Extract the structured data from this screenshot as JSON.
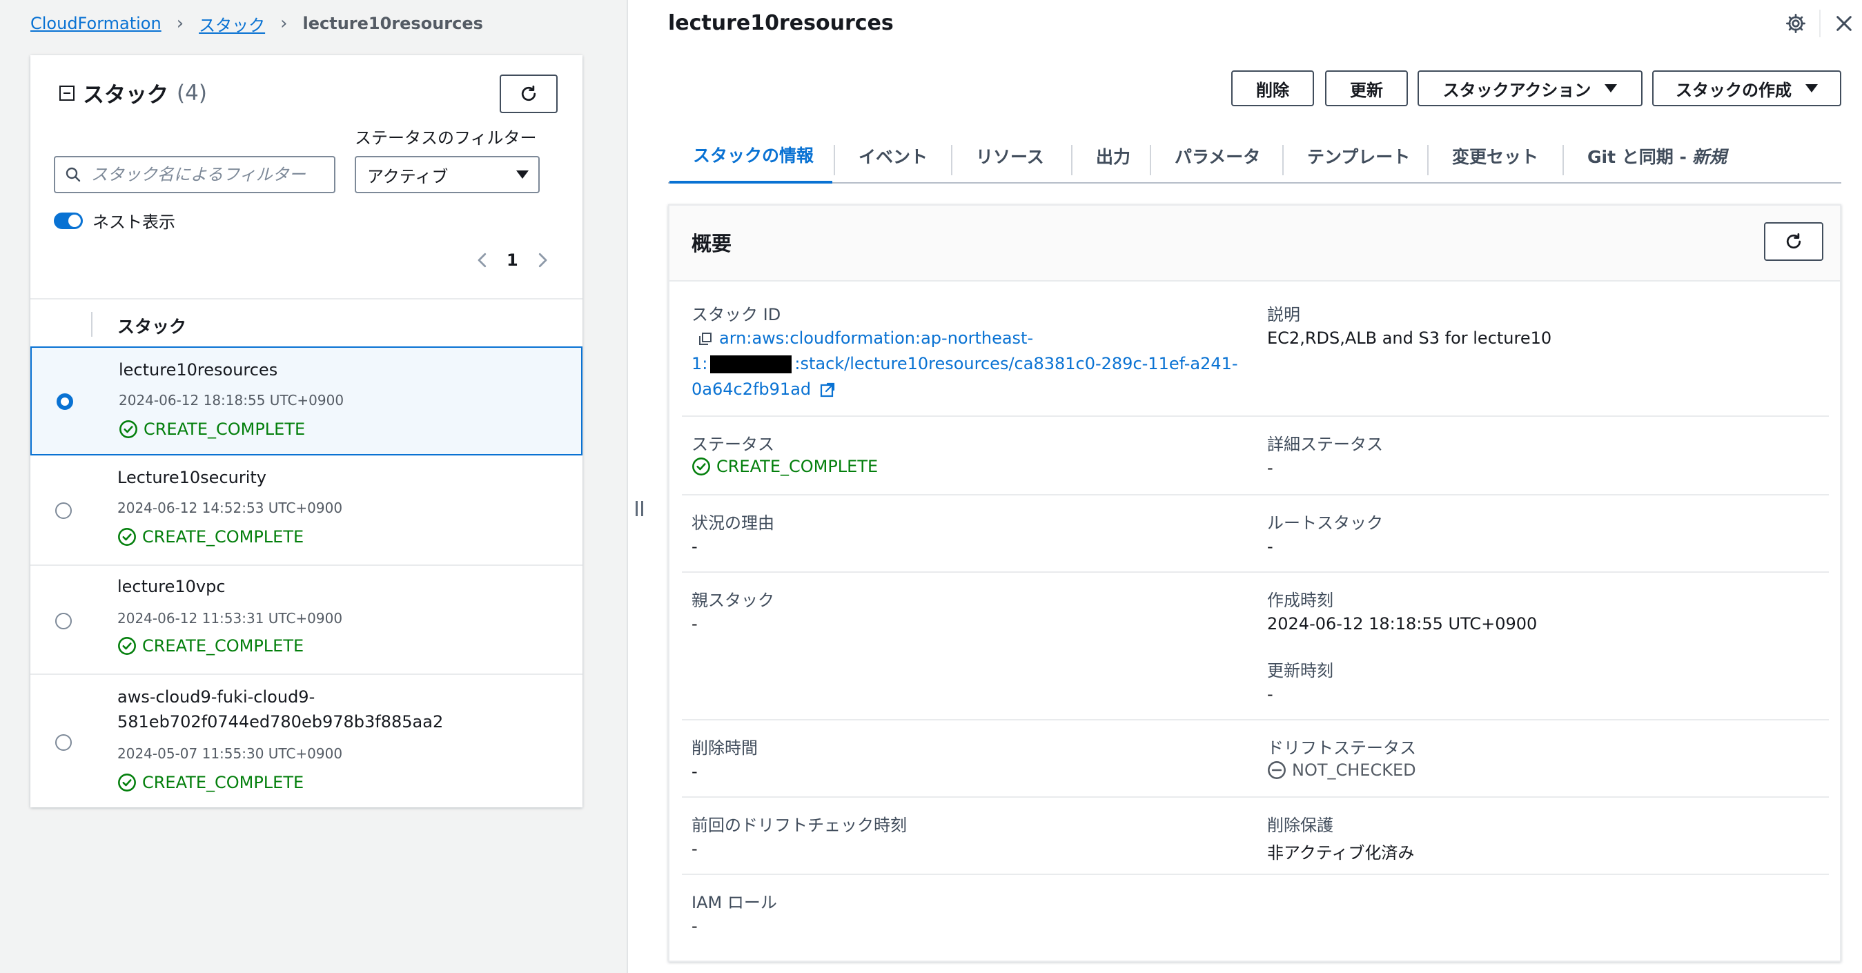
{
  "breadcrumb": {
    "root": "CloudFormation",
    "stacks": "スタック",
    "current": "lecture10resources"
  },
  "list_panel": {
    "title": "スタック",
    "count": "(4)",
    "filter_label": "ステータスのフィルター",
    "search_placeholder": "スタック名によるフィルター",
    "status_filter_value": "アクティブ",
    "nested_toggle_label": "ネスト表示",
    "nested_toggle_on": true,
    "page_number": "1",
    "column_header": "スタック",
    "rows": [
      {
        "name": "lecture10resources",
        "created": "2024-06-12 18:18:55 UTC+0900",
        "status": "CREATE_COMPLETE",
        "selected": true
      },
      {
        "name": "Lecture10security",
        "created": "2024-06-12 14:52:53 UTC+0900",
        "status": "CREATE_COMPLETE",
        "selected": false
      },
      {
        "name": "lecture10vpc",
        "created": "2024-06-12 11:53:31 UTC+0900",
        "status": "CREATE_COMPLETE",
        "selected": false
      },
      {
        "name_line1": "aws-cloud9-fuki-cloud9-",
        "name_line2": "581eb702f0744ed780eb978b3f885aa2",
        "created": "2024-05-07 11:55:30 UTC+0900",
        "status": "CREATE_COMPLETE",
        "selected": false
      }
    ]
  },
  "detail": {
    "title": "lecture10resources",
    "buttons": {
      "delete": "削除",
      "update": "更新",
      "stack_actions": "スタックアクション",
      "create_stack": "スタックの作成"
    },
    "tabs": [
      "スタックの情報",
      "イベント",
      "リソース",
      "出力",
      "パラメータ",
      "テンプレート",
      "変更セット",
      "Git と同期 -"
    ],
    "tab_new_badge": "新規",
    "overview": {
      "title": "概要",
      "stack_id_label": "スタック ID",
      "stack_id_line1": "arn:aws:cloudformation:ap-northeast-",
      "stack_id_line2_prefix": "1:",
      "stack_id_line2_suffix": ":stack/lecture10resources/ca8381c0-289c-11ef-a241-",
      "stack_id_line3": "0a64c2fb91ad",
      "description_label": "説明",
      "description_value": "EC2,RDS,ALB and S3 for lecture10",
      "status_label": "ステータス",
      "status_value": "CREATE_COMPLETE",
      "detailed_status_label": "詳細ステータス",
      "detailed_status_value": "-",
      "reason_label": "状況の理由",
      "reason_value": "-",
      "root_stack_label": "ルートスタック",
      "root_stack_value": "-",
      "parent_stack_label": "親スタック",
      "parent_stack_value": "-",
      "created_label": "作成時刻",
      "created_value": "2024-06-12 18:18:55 UTC+0900",
      "updated_label": "更新時刻",
      "updated_value": "-",
      "deleted_label": "削除時間",
      "deleted_value": "-",
      "drift_status_label": "ドリフトステータス",
      "drift_status_value": "NOT_CHECKED",
      "last_drift_label": "前回のドリフトチェック時刻",
      "last_drift_value": "-",
      "termination_protection_label": "削除保護",
      "termination_protection_value": "非アクティブ化済み",
      "iam_role_label": "IAM ロール",
      "iam_role_value": "-"
    }
  },
  "colors": {
    "link": "#0972d3",
    "success": "#037f0c",
    "text": "#16191f",
    "muted": "#545b64",
    "pane_bg": "#f2f3f3"
  },
  "icons": [
    "collapse-icon",
    "refresh-icon",
    "search-icon",
    "chevron-left-icon",
    "chevron-right-icon",
    "check-circle-icon",
    "gear-icon",
    "close-icon",
    "copy-icon",
    "external-link-icon",
    "minus-circle-icon",
    "caret-down-icon"
  ]
}
